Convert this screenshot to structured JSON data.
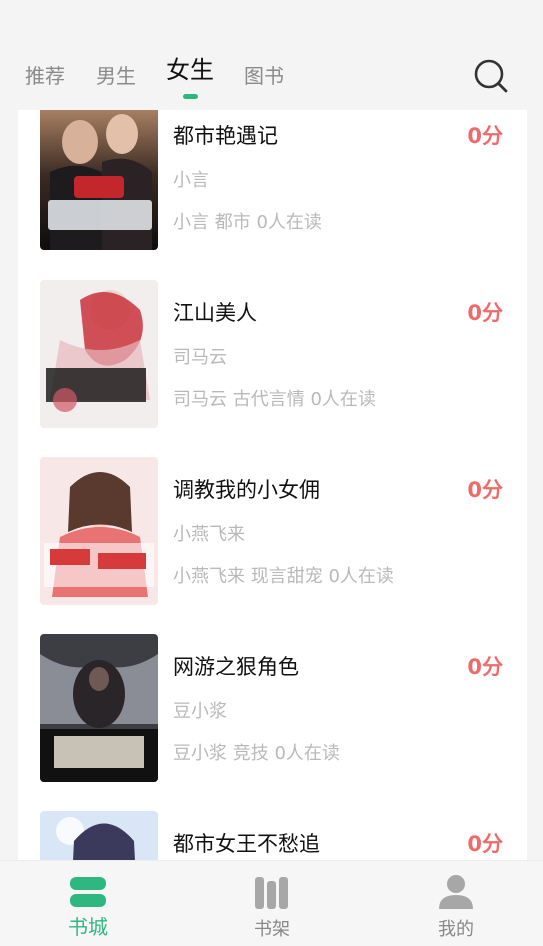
{
  "tabs": [
    {
      "label": "推荐"
    },
    {
      "label": "男生"
    },
    {
      "label": "女生"
    },
    {
      "label": "图书"
    }
  ],
  "active_tab": "女生",
  "icons": {
    "search": "search-icon",
    "store": "store-icon",
    "shelf": "bookshelf-icon",
    "profile": "profile-icon"
  },
  "colors": {
    "accent": "#2fb782",
    "score": "#ef6b6b",
    "muted": "#b9b9b9"
  },
  "books": [
    {
      "title": "都市艳遇记",
      "score": "0分",
      "author": "小言",
      "meta": "小言 都市 0人在读",
      "cover_text": "都市艳遇记"
    },
    {
      "title": "江山美人",
      "score": "0分",
      "author": "司马云",
      "meta": "司马云 古代言情 0人在读",
      "cover_text": "江山美人"
    },
    {
      "title": "调教我的小女佣",
      "score": "0分",
      "author": "小燕飞来",
      "meta": "小燕飞来 现言甜宠 0人在读",
      "cover_text": "调教我的小女佣"
    },
    {
      "title": "网游之狠角色",
      "score": "0分",
      "author": "豆小浆",
      "meta": "豆小浆 竞技 0人在读",
      "cover_text": "网游之狠角色"
    },
    {
      "title": "都市女王不愁追",
      "score": "0分",
      "author": "",
      "meta": "",
      "cover_text": ""
    }
  ],
  "bottom_nav": [
    {
      "label": "书城"
    },
    {
      "label": "书架"
    },
    {
      "label": "我的"
    }
  ]
}
